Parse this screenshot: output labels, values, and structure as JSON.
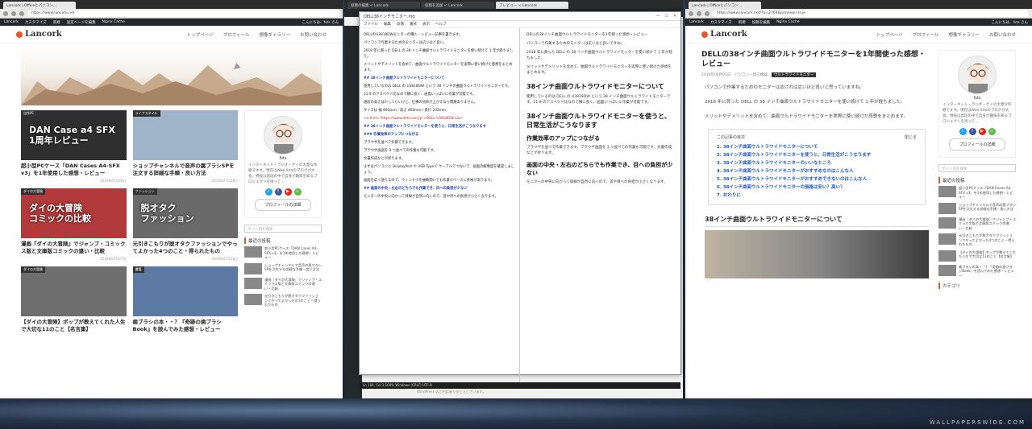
{
  "left": {
    "tabs": [
      "Lancork | Officeとパソコン..."
    ],
    "url": "https://www.lancork.net",
    "wpbar": {
      "site": "Lancork",
      "customize": "カスタマイズ",
      "new": "新規",
      "edit": "固定ページを編集",
      "cache": "Nginx Cache",
      "greeting": "こんにちは、fsts さん"
    },
    "logo": "Lancork",
    "nav": [
      "トップページ",
      "プロフィール",
      "想像ギャラリー",
      "お問い合わせ"
    ],
    "cards": [
      {
        "cat": "自作PC",
        "caption": "DAN Case a4 SFX\n1周年レビュー",
        "title": "超小型PCケース「DAN Cases A4-SFX v3」を1年使用した感想・レビュー",
        "date": "2019年07月28日",
        "color": "#2f2f2f"
      },
      {
        "cat": "ライフスタイル",
        "caption": "",
        "title": "ショップチャンネルで音声の腐プラシSPを注文する詳細な手順・良い方法",
        "date": "2019年07月28日",
        "color": "#9fb4c8"
      },
      {
        "cat": "ダイの大冒険",
        "caption": "ダイの大冒険\nコミックの比較",
        "title": "漫画『ダイの大冒険』でジャンプ・コミックス版と文庫版コミックの違い・比較",
        "date": "2019年07月27日",
        "color": "#b33a3a"
      },
      {
        "cat": "ファッション",
        "caption": "脱オタク\nファッション",
        "title": "元引きこもりが脱オタクファッションでやってよかった4つのこと・得られたもの",
        "date": "2019年07月26日",
        "color": "#6a6a6a"
      },
      {
        "cat": "ダイの大冒険",
        "caption": "",
        "title": "【ダイの大冒険】ポップが教えてくれた人生で大切な11のこと【名言集】",
        "date": "",
        "color": "#6e6e6e"
      },
      {
        "cat": "書籍",
        "caption": "",
        "title": "歯ブラシの本・・？『奇跡の歯ブラシBook』を読んでみた感想・レビュー",
        "date": "",
        "color": "#5d7aa5"
      }
    ],
    "profile": {
      "name": "fsts",
      "bio": "インターネット・ラジオ・ゲイの大量な作戦ですす。現在はWeb Siteのブログが大会。特技は普段の中で自身が趣味を知るプロジェクトを持って…",
      "button": "プロフィールの詳細"
    },
    "search_placeholder": "サイト内を検索",
    "recent_heading": "最近の投稿",
    "recent": [
      "超小型PCケース「DAN Cases A4-SFX v3」を1年使用した感想・レビュー",
      "ショップチャンネルで音声の腐プラシSPを注文する詳細な手順・良い方法",
      "漫画『ダイの大冒険』でジャンプ・コミックス版と文庫版コミックの違い・比較",
      "元引きこもりが脱オタクファッションでやってよかった4つのこと・得られたもの"
    ]
  },
  "middle": {
    "tabs": [
      "投稿の編集 < Lancork",
      "投稿を追加 < Lancork",
      "プレビュー < Lancork"
    ],
    "editor_title": "DELL38インチモニター.md",
    "menu": [
      "ファイル",
      "編集",
      "段落",
      "書式",
      "表示",
      "ヘルプ"
    ],
    "src_lines": [
      "DELLのU3818DWモニターの購入・レビュー記事を書きます。",
      "パソコンで作業するためのモニターは広いほど良い。",
      "2018 年に買った DELL の 38 インチ曲面ウルトラワイドモニターを使い続けて 1 年が経ちました。",
      "メリットやデメリットを含めて、曲面ウルトラワイドモニターを実際に使い続けた感想をまとめます。",
      "## 38インチ曲面ウルトラワイドモニターについて",
      "使用しているのは DELL の U3818DW という 38 インチの曲面ウルトラワイドモニターです。",
      "21:9 のアスペクト比なので横に長く、画面いっぱいに作業が可能です。",
      "値段の高さは少しつらいけど、仕事の効率が上がるなら問題ありません。",
      "サイズは 幅 895mm / 高さ 464mm / 奥行 232mm",
      "<a href=\"https://www.dell.com/jp\">DELL U3818DW</a>",
      "## 38インチ曲面ウルトラワイドモニターを使うと、日常生活がこうなります",
      "### 作業効率のアップにつながる",
      "ブラウザを並べて作業できます。",
      "ブラウザ画面を 3 つ並べての作業も可能です。",
      "文書作成などが捗ります。",
      "まずはパソコンと DisplayPort や USB Type-C ケーブルでつないで、画面の解像度を確認しましょう。",
      "画面を広く使えるので、ウィンドウを複数開いても作業スペースに余裕があります。",
      "## 画面の中央・左右のどちらでも作業でき、目への負担が少ない",
      "モニターの中央に向かって目線が自然に向くので、首や目への負担が小さくなります。"
    ],
    "preview": {
      "intro": [
        "DELLの38インチ曲面ウルトラワイドモニターを1年使った感想・レビュー",
        "パソコンで作業するためのモニターは広いほど良いですね。",
        "2018 年に買った DELL の 38 インチ曲面ウルトラワイドモニターを使い続けて 1 年が経ちました。",
        "メリットやデメリットを含めて、曲面ウルトラワイドモニターを実際に使い続けた感想をまとめます。"
      ],
      "h2a": "38インチ曲面ウルトラワイドモニターについて",
      "pa": "使用しているのは DELL の U3818DW という 38 インチ曲面ウルトラワイドモニターです。21:9 のアスペクト比なので横に長く、画面いっぱいに作業が可能です。",
      "h2b": "38インチ曲面ウルトラワイドモニターを使うと、日常生活がこうなります",
      "h3": "作業効率のアップにつながる",
      "pb": "ブラウザを並べて作業できます。ブラウザ画面を 3 つ並べての作業も可能です。文書作成などが捗ります。",
      "h3b": "画面の中央・左右のどちらでも作業でき、目への負担が少ない",
      "pc": "モニターの中央に向かって目線が自然に向くので、首や目への負担が小さくなります。"
    },
    "status": "Ln 104, Col 1    100%    Windows (CRLF)    UTF-8",
    "footer": "WordPress のご利用ありがとうございます。"
  },
  "right": {
    "tabs": [
      "Lancork | Officeとパソコン..."
    ],
    "url": "https://www.lancork.net/?p=2769&preview=true",
    "wpbar": {
      "site": "Lancork",
      "customize": "カスタマイズ",
      "new": "新規",
      "edit": "投稿を編集",
      "cache": "Nginx Cache",
      "greeting": "こんにちは、fsts さん"
    },
    "logo": "Lancork",
    "nav": [
      "トップページ",
      "プロフィール",
      "想像ギャラリー",
      "お問い合わせ"
    ],
    "title": "DELLの38インチ曲面ウルトラワイドモニターを1年間使った感想・レビュー",
    "date": "2019年08月01日",
    "category": "パソコン・周辺機器",
    "tag": "ウルトラワイドモニター",
    "paras": [
      "パソコンで作業するためのモニターは広ければ広いほど良いと思っていますね。",
      "2018 年に買った DELL の 38 インチ曲面ウルトラワイドモニターを使い続けて 1 年が経ちました。",
      "メリットやデメリットを含めて、曲面ウルトラワイドモニターを実際に使い続けた感想をまとめます。"
    ],
    "toc_title": "この記事の目次",
    "toc_toggle": "閉じる",
    "toc": [
      "1. 38インチ曲面ウルトラワイドモニターについて",
      "2. 38インチ曲面ウルトラワイドモニターを使うと、日常生活がこうなります",
      "3. 38インチ曲面ウルトラワイドモニターのいいなところ",
      "4. 38インチ曲面ウルトラワイドモニターがおすすめなのはこんな人",
      "5. 38インチ曲面ウルトラワイドモニターがおすすめできないのはこんな人",
      "6. 38インチ曲面ウルトラワイドモニターの価格は安い？高い？",
      "7. おわりに"
    ],
    "h2": "38インチ曲面ウルトラワイドモニターについて",
    "profile": {
      "name": "fsts",
      "bio": "インターネット・ラジオ・ゲイの大量な作戦ですす。現在はWeb Siteのブログが大会。特技は普段の中で自身が趣味を知るプロジェクトを持って…",
      "button": "プロフィールの詳細"
    },
    "search_placeholder": "サイト内を検索",
    "recent_heading": "最近の投稿",
    "recent": [
      "超小型PCケース「DAN Cases A4-SFX v3」を1年使用した感想・レビュー",
      "ショップチャンネルで音声の腐プラシSPを注文する詳細な手順・良い方法",
      "漫画『ダイの大冒険』でジャンプ・コミックス版と文庫版コミックの違い・比較",
      "元引きこもりが脱オタクファッションでやってよかった4つのこと・得られたもの",
      "【ダイの大冒険】ポップが教えてくれた人生で大切な11のこと【名言集】",
      "歯ブラシの本・・？『奇跡の歯ブラシBook』を読んでみた感想・レビュー"
    ],
    "category_heading": "カテゴリ"
  },
  "desktop": {
    "watermark": "WALLPAPERSWIDE.COM"
  },
  "colors": {
    "accent": "#e55a2b",
    "link": "#1f59c8",
    "wpbar": "#23282d"
  }
}
